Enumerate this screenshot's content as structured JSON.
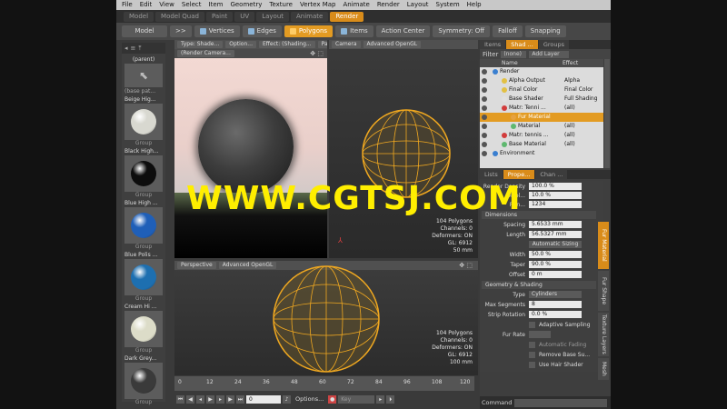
{
  "menu": [
    "File",
    "Edit",
    "View",
    "Select",
    "Item",
    "Geometry",
    "Texture",
    "Vertex Map",
    "Animate",
    "Render",
    "Layout",
    "System",
    "Help"
  ],
  "layout_tabs": [
    {
      "label": "Model",
      "active": false
    },
    {
      "label": "Model Quad",
      "active": false
    },
    {
      "label": "Paint",
      "active": false
    },
    {
      "label": "UV",
      "active": false
    },
    {
      "label": "Layout",
      "active": false
    },
    {
      "label": "Animate",
      "active": false
    },
    {
      "label": "Render",
      "active": true
    }
  ],
  "toolbar": {
    "mode": "Model",
    "arrows": ">>",
    "vertices": "Vertices",
    "edges": "Edges",
    "polygons": "Polygons",
    "items": "Items",
    "action_center": "Action Center",
    "symmetry": "Symmetry: Off",
    "falloff": "Falloff",
    "snapping": "Snapping"
  },
  "presets": {
    "parent": "(parent)",
    "base_label": "(base pat...",
    "items": [
      {
        "label": "Beige Hig...",
        "group": "Group",
        "color": "#d8d8d0"
      },
      {
        "label": "Black High...",
        "group": "Group",
        "color": "#0d0d0d"
      },
      {
        "label": "Blue High ...",
        "group": "Group",
        "color": "#1f5fb8"
      },
      {
        "label": "Blue Polis ...",
        "group": "Group",
        "color": "#1d6fb0"
      },
      {
        "label": "Cream Hi ...",
        "group": "Group",
        "color": "#dcdcc8"
      },
      {
        "label": "Dark Grey...",
        "group": "Group",
        "color": "#3a3a3a"
      }
    ]
  },
  "viewport_render": {
    "type": "Type: Shade...",
    "options": "Option...",
    "effect": "Effect: (Shading...",
    "pause": "Pause",
    "camera": "(Render Camera..."
  },
  "viewport_camera": {
    "label": "Camera",
    "mode": "Advanced OpenGL",
    "stats": [
      "104 Polygons",
      "Channels: 0",
      "Deformers: ON",
      "GL: 6912",
      "50 mm"
    ]
  },
  "viewport_persp": {
    "label": "Perspective",
    "mode": "Advanced OpenGL",
    "stats": [
      "104 Polygons",
      "Channels: 0",
      "Deformers: ON",
      "GL: 6912",
      "100 mm"
    ]
  },
  "right_tabs": [
    {
      "label": "Items",
      "active": false
    },
    {
      "label": "Shad ...",
      "active": true
    },
    {
      "label": "Groups",
      "active": false
    }
  ],
  "shader": {
    "filter_label": "Filter",
    "filter_value": "(none)",
    "add_layer": "Add Layer",
    "col_name": "Name",
    "col_effect": "Effect",
    "rows": [
      {
        "name": "Render",
        "effect": "",
        "indent": 14,
        "color": "#3a7fd0",
        "sel": false
      },
      {
        "name": "Alpha Output",
        "effect": "Alpha",
        "indent": 24,
        "color": "#e2c044",
        "sel": false
      },
      {
        "name": "Final Color",
        "effect": "Final Color",
        "indent": 24,
        "color": "#e2c044",
        "sel": false
      },
      {
        "name": "Base Shader",
        "effect": "Full Shading",
        "indent": 24,
        "color": "#e0e0e0",
        "sel": false
      },
      {
        "name": "Matr: Tenni ...",
        "effect": "(all)",
        "indent": 24,
        "color": "#d23c3c",
        "sel": false
      },
      {
        "name": "Fur Material",
        "effect": "",
        "indent": 34,
        "color": "#e6a240",
        "sel": true
      },
      {
        "name": "Material",
        "effect": "(all)",
        "indent": 34,
        "color": "#5fb86f",
        "sel": false
      },
      {
        "name": "Matr: tennis ...",
        "effect": "(all)",
        "indent": 24,
        "color": "#d23c3c",
        "sel": false
      },
      {
        "name": "Base Material",
        "effect": "(all)",
        "indent": 24,
        "color": "#5fb86f",
        "sel": false
      },
      {
        "name": "Environment",
        "effect": "",
        "indent": 14,
        "color": "#3a7fd0",
        "sel": false
      }
    ]
  },
  "prop_tabs": [
    {
      "label": "Lists",
      "active": false
    },
    {
      "label": "Prope...",
      "active": true
    },
    {
      "label": "Chan ...",
      "active": false
    }
  ],
  "props": {
    "render_density": {
      "label": "Render Density",
      "value": "100.0 %"
    },
    "display": {
      "label": "Displ...",
      "value": "10.0 %"
    },
    "random": {
      "label": "Ran...",
      "value": "1234"
    },
    "dimensions": "Dimensions",
    "spacing": {
      "label": "Spacing",
      "value": "5.6533 mm"
    },
    "length": {
      "label": "Length",
      "value": "56.5327 mm"
    },
    "auto_sizing": "Automatic Sizing",
    "width": {
      "label": "Width",
      "value": "50.0 %"
    },
    "taper": {
      "label": "Taper",
      "value": "90.0 %"
    },
    "offset": {
      "label": "Offset",
      "value": "0 m"
    },
    "geometry": "Geometry & Shading",
    "type": {
      "label": "Type",
      "value": "Cylinders"
    },
    "max_segments": {
      "label": "Max Segments",
      "value": "8"
    },
    "strip_rotation": {
      "label": "Strip Rotation",
      "value": "0.0 %"
    },
    "adaptive": "Adaptive Sampling",
    "fur_rate": {
      "label": "Fur Rate"
    },
    "auto_fading": "Automatic Fading",
    "remove_base": "Remove Base Su...",
    "use_hair": "Use Hair Shader"
  },
  "vertical_tabs": [
    {
      "label": "Fur Material",
      "active": true
    },
    {
      "label": "Fur Shape",
      "active": false
    },
    {
      "label": "Texture Layers",
      "active": false
    },
    {
      "label": "Mesh",
      "active": false
    }
  ],
  "timeline": {
    "ticks": [
      "0",
      "12",
      "24",
      "36",
      "48",
      "60",
      "72",
      "84",
      "96",
      "108",
      "120"
    ],
    "frame": "0",
    "options": "Options...",
    "key": "Key"
  },
  "command_label": "Command",
  "watermark": "WWW.CGTSJ.COM"
}
